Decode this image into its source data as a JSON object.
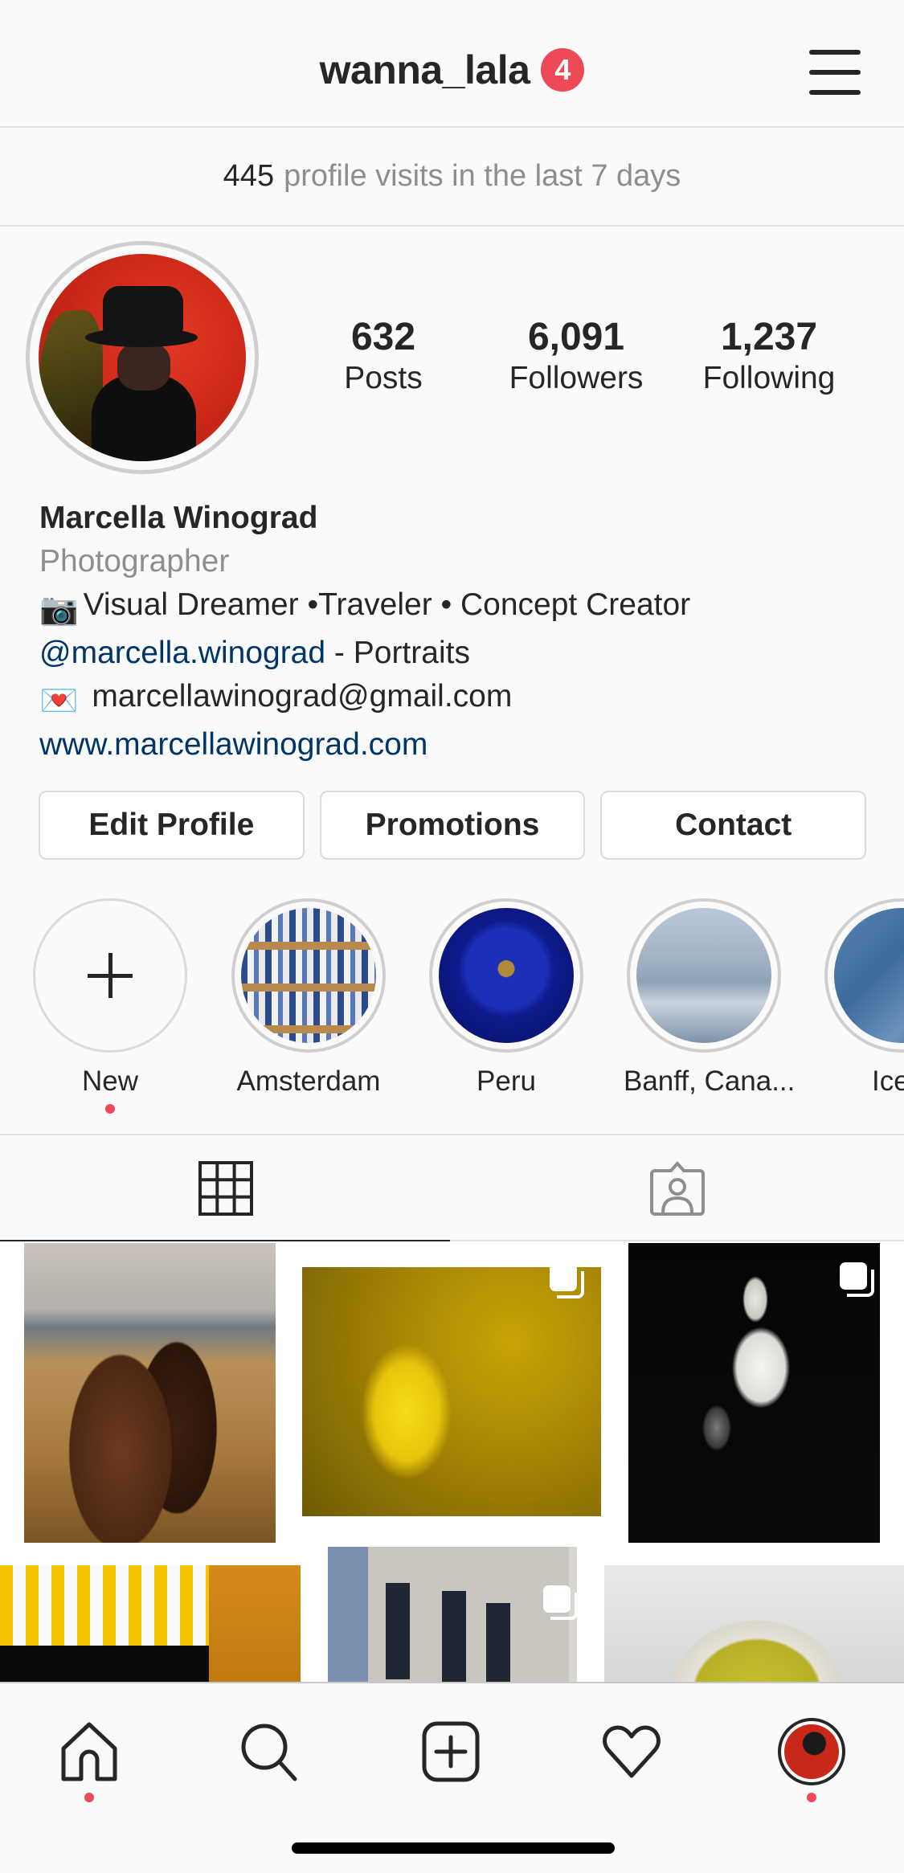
{
  "header": {
    "username": "wanna_lala",
    "notification_count": "4",
    "menu_icon": "hamburger-menu-icon"
  },
  "visits": {
    "count": "445",
    "text": "profile visits in the last 7 days"
  },
  "profile": {
    "stats": [
      {
        "value": "632",
        "label": "Posts"
      },
      {
        "value": "6,091",
        "label": "Followers"
      },
      {
        "value": "1,237",
        "label": "Following"
      }
    ],
    "name": "Marcella Winograd",
    "category": "Photographer",
    "bio": {
      "line1_emoji": "📷",
      "line1": "Visual Dreamer •Traveler • Concept Creator",
      "mention": "@marcella.winograd",
      "mention_suffix": " - Portraits",
      "email_emoji": "💌",
      "email": "marcellawinograd@gmail.com",
      "website": "www.marcellawinograd.com"
    }
  },
  "buttons": {
    "edit_profile": "Edit Profile",
    "promotions": "Promotions",
    "contact": "Contact"
  },
  "highlights": [
    {
      "label": "New",
      "type": "new"
    },
    {
      "label": "Amsterdam"
    },
    {
      "label": "Peru"
    },
    {
      "label": "Banff, Cana..."
    },
    {
      "label": "Icela"
    }
  ],
  "tabs": [
    {
      "name": "grid",
      "icon": "grid-icon",
      "active": true
    },
    {
      "name": "tagged",
      "icon": "tagged-person-icon",
      "active": false
    }
  ],
  "grid_posts": [
    {
      "subject": "Icelandic horses by a fence",
      "multiple": false
    },
    {
      "subject": "Yellow forsythia blossoms",
      "multiple": true
    },
    {
      "subject": "White flowers on black",
      "multiple": true
    },
    {
      "subject": "Panaderia storefront with yellow awning",
      "multiple": false
    },
    {
      "subject": "Brick building street corner",
      "multiple": true
    },
    {
      "subject": "Green soup in bowl",
      "multiple": false
    }
  ],
  "bottom_nav": [
    {
      "name": "home",
      "icon": "home-icon",
      "dot": true
    },
    {
      "name": "search",
      "icon": "search-icon",
      "dot": false
    },
    {
      "name": "new-post",
      "icon": "add-post-icon",
      "dot": false
    },
    {
      "name": "activity",
      "icon": "heart-icon",
      "dot": false
    },
    {
      "name": "profile",
      "icon": "profile-avatar-icon",
      "dot": true
    }
  ],
  "colors": {
    "accent_red": "#ed4956",
    "link_blue": "#003569",
    "text_primary": "#262626",
    "text_secondary": "#8e8e8e"
  }
}
